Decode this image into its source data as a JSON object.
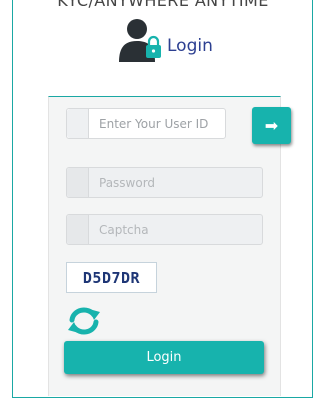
{
  "banner": {
    "text": "KYC/ANYWHERE ANYTIME"
  },
  "heading": {
    "text": "Login",
    "icon": "user-lock-icon",
    "icon_color": "#2a3035",
    "lock_color": "#17b3ad"
  },
  "form": {
    "user_id": {
      "placeholder": "Enter Your User ID",
      "value": ""
    },
    "submit_user_id": {
      "icon": "arrow-right-icon",
      "glyph": "➡"
    },
    "password": {
      "placeholder": "Password",
      "value": ""
    },
    "captcha_input": {
      "placeholder": "Captcha",
      "value": ""
    },
    "captcha_code": "D5D7DR",
    "refresh": {
      "icon": "refresh-icon",
      "color": "#17b3ad"
    },
    "login_label": "Login"
  },
  "colors": {
    "accent": "#17b3ad",
    "heading": "#2c3f91",
    "captcha_text": "#1e3676"
  }
}
